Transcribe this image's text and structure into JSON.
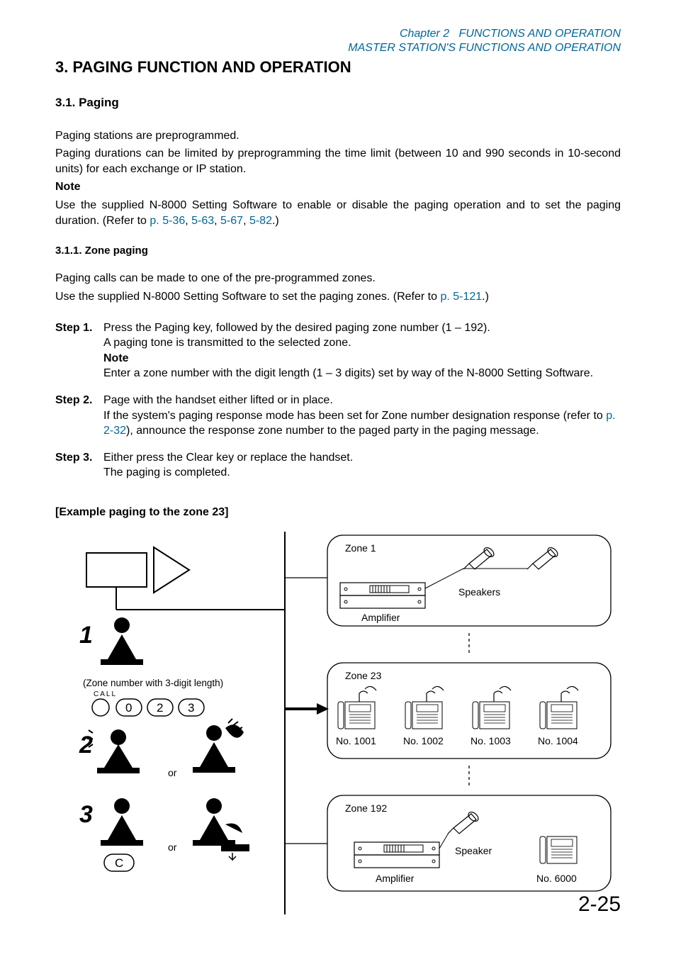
{
  "header": {
    "chapter": "Chapter 2",
    "chapter_title": "FUNCTIONS AND OPERATION",
    "subtitle": "MASTER STATION'S FUNCTIONS AND OPERATION"
  },
  "h1": "3. PAGING FUNCTION AND OPERATION",
  "h2": "3.1. Paging",
  "intro": {
    "p1": "Paging stations are preprogrammed.",
    "p2": "Paging durations can be limited by preprogramming the time limit (between 10 and 990 seconds in 10-second units) for each exchange or IP station.",
    "note_label": "Note",
    "note_a": "Use the supplied N-8000 Setting Software to enable or disable the paging operation and to set the paging duration. (Refer to ",
    "link1": "p. 5-36",
    "sep1": ", ",
    "link2": "5-63",
    "sep2": ", ",
    "link3": "5-67",
    "sep3": ", ",
    "link4": "5-82",
    "note_b": ".)"
  },
  "h3": "3.1.1. Zone paging",
  "zone": {
    "p1": "Paging calls can be made to one of the pre-programmed zones.",
    "p2a": "Use the supplied N-8000 Setting Software to set the paging zones. (Refer to ",
    "p2_link": "p. 5-121",
    "p2b": ".)"
  },
  "steps": {
    "s1_label": "Step 1.",
    "s1_l1": "Press the Paging key, followed by the desired paging zone number (1 – 192).",
    "s1_l2": "A paging tone is transmitted to the selected zone.",
    "s1_note": "Note",
    "s1_l3": "Enter a zone number with the digit length (1 – 3 digits) set by way of the N-8000 Setting Software.",
    "s2_label": "Step 2.",
    "s2_l1": "Page with the handset either lifted or in place.",
    "s2_l2a": "If the system's paging response mode has been set for Zone number designation response (refer to ",
    "s2_link": "p. 2-32",
    "s2_l2b": "), announce the response zone number to the paged party in the paging message.",
    "s3_label": "Step 3.",
    "s3_l1": "Either press the Clear key or replace the handset.",
    "s3_l2": "The paging is completed."
  },
  "example_title": "[Example paging to the zone 23]",
  "diagram": {
    "step_1": "1",
    "step_2": "2",
    "step_3": "3",
    "zone_digits_caption": "(Zone number with 3-digit length)",
    "call_label": "CALL",
    "digit_0": "0",
    "digit_2": "2",
    "digit_3": "3",
    "or_1": "or",
    "or_2": "or",
    "clear_key": "C",
    "zone1_label": "Zone 1",
    "zone1_amp": "Amplifier",
    "zone1_spk": "Speakers",
    "zone23_label": "Zone 23",
    "zone23_no1": "No. 1001",
    "zone23_no2": "No. 1002",
    "zone23_no3": "No. 1003",
    "zone23_no4": "No. 1004",
    "zone192_label": "Zone 192",
    "zone192_amp": "Amplifier",
    "zone192_spk": "Speaker",
    "zone192_no": "No. 6000"
  },
  "page_number": "2-25"
}
